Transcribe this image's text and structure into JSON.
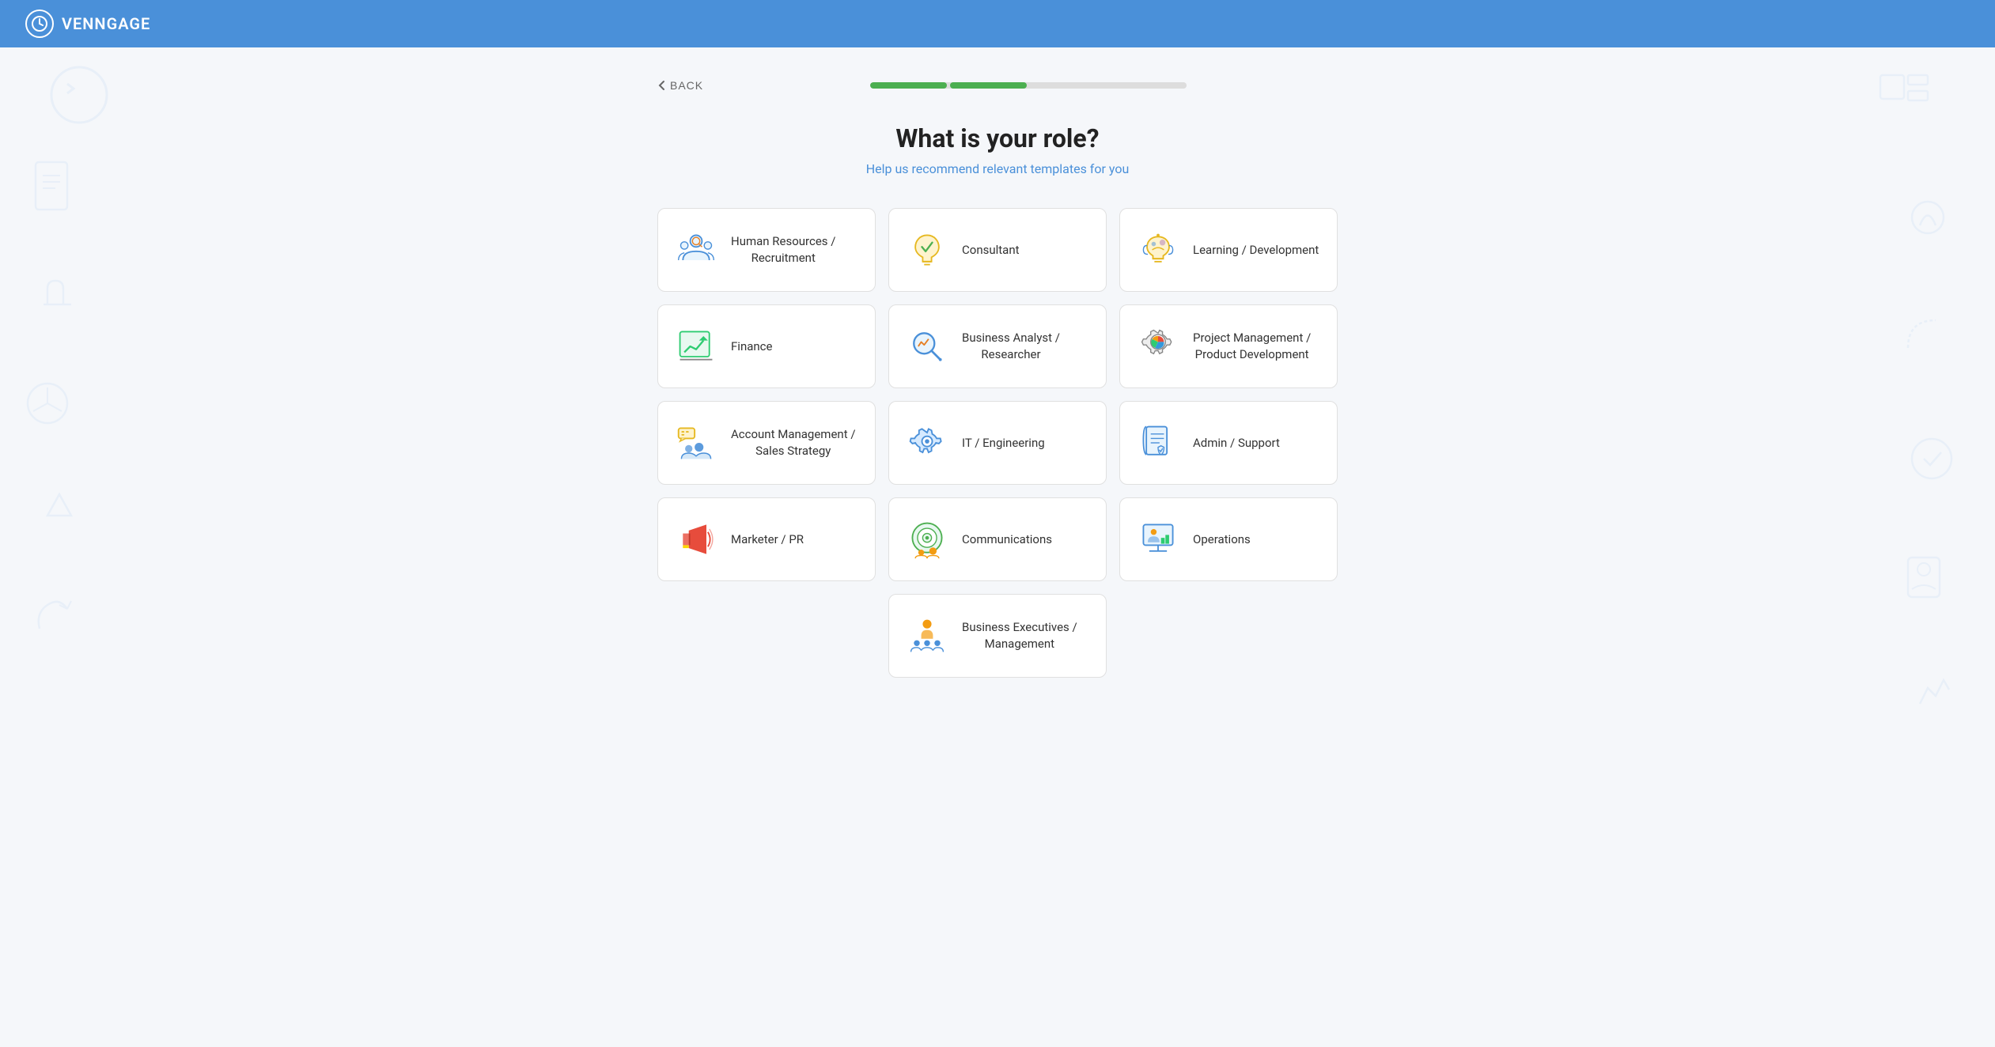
{
  "header": {
    "logo_text": "VENNGAGE",
    "logo_icon": "⏱"
  },
  "nav": {
    "back_label": "BACK"
  },
  "progress": {
    "filled_segments": 2,
    "empty_segments": 2
  },
  "page": {
    "title": "What is your role?",
    "subtitle": "Help us recommend relevant templates for you"
  },
  "roles": [
    {
      "id": "human-resources",
      "label": "Human Resources /\nRecruitment",
      "icon": "hr"
    },
    {
      "id": "consultant",
      "label": "Consultant",
      "icon": "consultant"
    },
    {
      "id": "learning-development",
      "label": "Learning / Development",
      "icon": "learning"
    },
    {
      "id": "finance",
      "label": "Finance",
      "icon": "finance"
    },
    {
      "id": "business-analyst",
      "label": "Business Analyst /\nResearcher",
      "icon": "analyst"
    },
    {
      "id": "project-management",
      "label": "Project Management /\nProduct Development",
      "icon": "project"
    },
    {
      "id": "account-management",
      "label": "Account Management /\nSales Strategy",
      "icon": "sales"
    },
    {
      "id": "it-engineering",
      "label": "IT / Engineering",
      "icon": "it"
    },
    {
      "id": "admin-support",
      "label": "Admin / Support",
      "icon": "admin"
    },
    {
      "id": "marketer-pr",
      "label": "Marketer / PR",
      "icon": "marketer"
    },
    {
      "id": "communications",
      "label": "Communications",
      "icon": "communications"
    },
    {
      "id": "operations",
      "label": "Operations",
      "icon": "operations"
    },
    {
      "id": "business-executives",
      "label": "Business Executives /\nManagement",
      "icon": "executives"
    }
  ]
}
